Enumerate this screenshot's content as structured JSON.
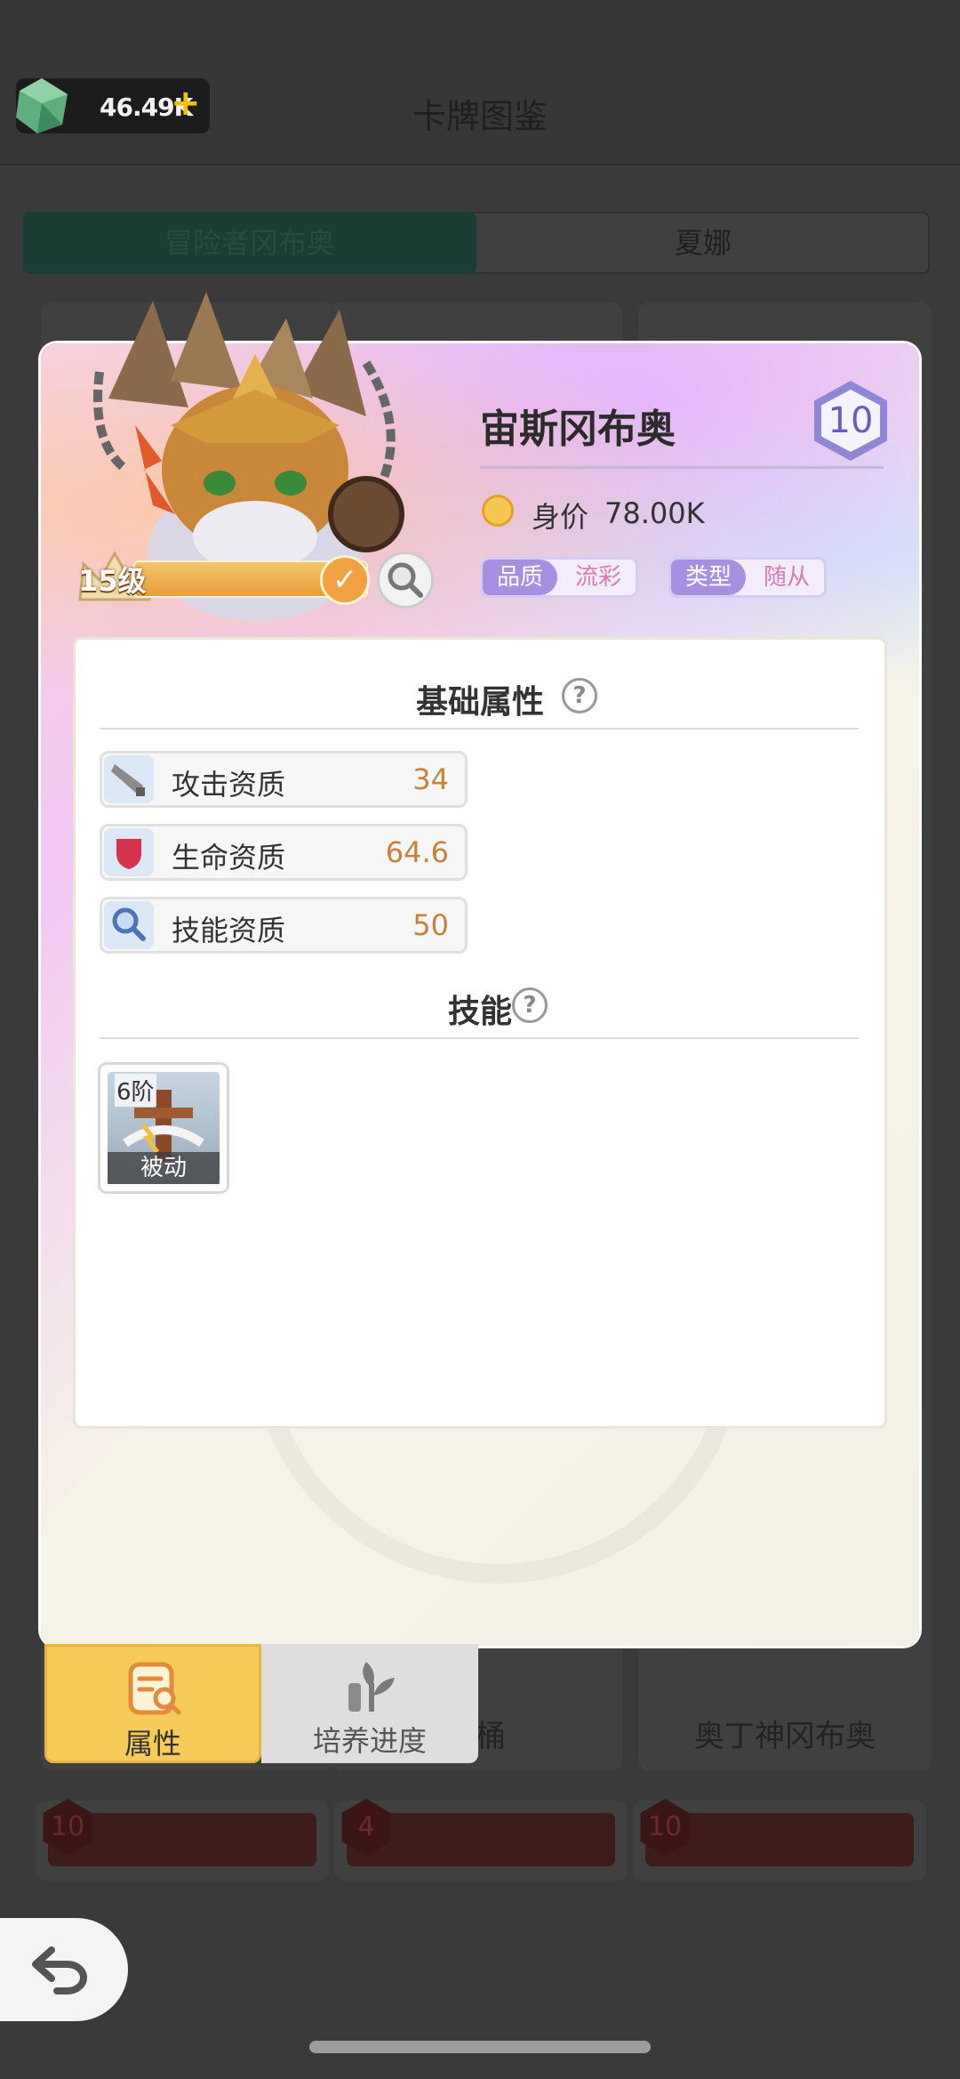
{
  "header": {
    "currency_value": "46.49K",
    "currency_plus": "+",
    "title": "卡牌图鉴"
  },
  "background_tabs": [
    "冒险者冈布奥",
    "夏娜"
  ],
  "background_cards": [
    {
      "name": "酒桶"
    },
    {
      "name": "奥丁神冈布奥"
    }
  ],
  "background_badges": [
    "10",
    "4",
    "10"
  ],
  "hero": {
    "name": "宙斯冈布奥",
    "level_badge": "10",
    "level_text": "15级",
    "price_label": "身价",
    "price_value": "78.00K",
    "quality_label": "品质",
    "quality_value": "流彩",
    "type_label": "类型",
    "type_value": "随从"
  },
  "attributes_section": {
    "title": "基础属性",
    "help": "?",
    "rows": [
      {
        "label": "攻击资质",
        "value": "34",
        "icon": "sword-icon"
      },
      {
        "label": "生命资质",
        "value": "64.6",
        "icon": "heart-shield-icon"
      },
      {
        "label": "技能资质",
        "value": "50",
        "icon": "magnifier-icon"
      }
    ]
  },
  "skills_section": {
    "title": "技能",
    "help": "?",
    "skills": [
      {
        "tier": "6阶",
        "type": "被动"
      }
    ]
  },
  "bottom_tabs": [
    {
      "label": "属性",
      "icon": "clipboard-search-icon",
      "active": true
    },
    {
      "label": "培养进度",
      "icon": "sprout-icon",
      "active": false
    }
  ],
  "colors": {
    "accent_gold": "#f6cb5a",
    "value_orange": "#c48339",
    "quality_pink": "#d87ab6",
    "pill_purple": "#a78fe2"
  }
}
